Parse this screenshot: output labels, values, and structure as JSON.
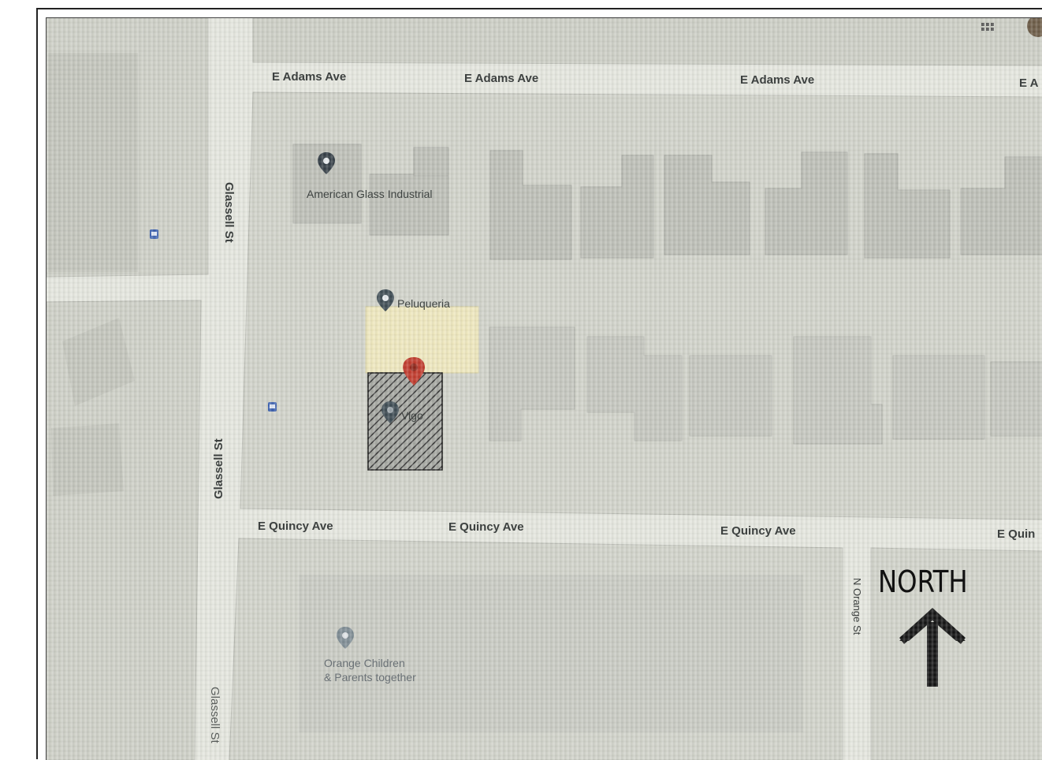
{
  "streets": {
    "e_adams_1": "E Adams Ave",
    "e_adams_2": "E Adams Ave",
    "e_adams_3": "E Adams Ave",
    "e_adams_4": "E A",
    "e_quincy_1": "E Quincy Ave",
    "e_quincy_2": "E Quincy Ave",
    "e_quincy_3": "E Quincy Ave",
    "e_quincy_4": "E Quin",
    "glassell_1": "Glassell St",
    "glassell_2": "Glassell St",
    "glassell_3": "Glassell St",
    "n_orange": "N Orange St"
  },
  "pois": {
    "american_glass": "American Glass Industrial",
    "peluqueria": "Peluqueria",
    "vigo": "Vigo",
    "orange_children_1": "Orange Children",
    "orange_children_2": "& Parents together"
  },
  "north": {
    "label": "NORTH"
  },
  "colors": {
    "map_bg": "#d7d9cf",
    "block": "#c8cac1",
    "building": "#bcbdb6",
    "road": "#eceee8",
    "pin_dark": "#3c4a52",
    "pin_light": "#7d8b93",
    "pin_red": "#c0392b",
    "highlight": "#f2ecc0",
    "hatch": "#333333"
  }
}
